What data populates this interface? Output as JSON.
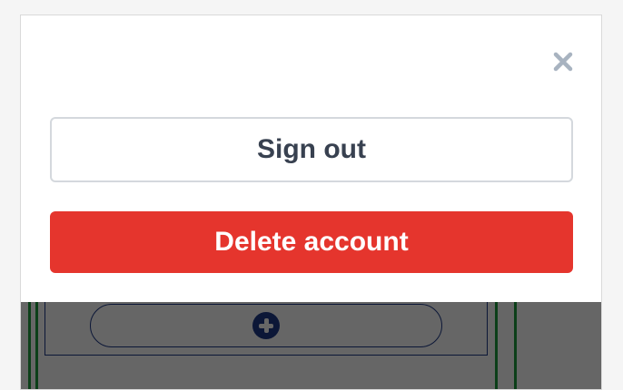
{
  "modal": {
    "close_icon": "close-icon",
    "sign_out_label": "Sign out",
    "delete_account_label": "Delete account"
  },
  "background": {
    "add_icon": "plus-circle-icon"
  },
  "colors": {
    "danger": "#e5352d",
    "secondary_text": "#384150",
    "close_icon": "#a8b3c0",
    "accent_blue": "#1e3a8a",
    "accent_green": "#1f9d3f",
    "overlay": "rgba(0,0,0,0.6)"
  }
}
